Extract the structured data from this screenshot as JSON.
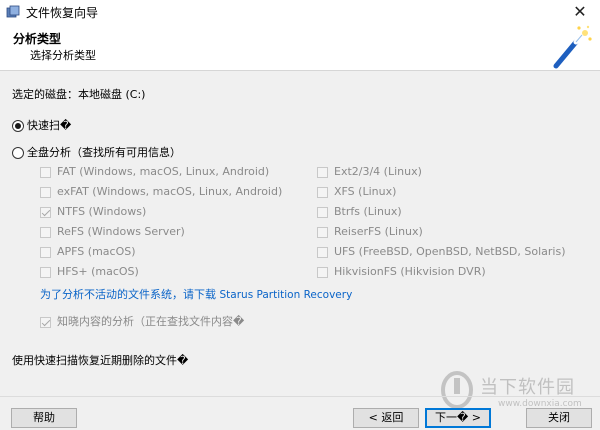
{
  "window": {
    "title": "文件恢复向导",
    "close_glyph": "✕"
  },
  "header": {
    "title": "分析类型",
    "subtitle": "选择分析类型"
  },
  "disk": {
    "label": "选定的磁盘：本地磁盘 (C:)"
  },
  "options": {
    "quick_scan": {
      "label": "快速扫�",
      "selected": true
    },
    "full_analysis": {
      "label": "全盘分析（查找所有可用信息）",
      "selected": false
    }
  },
  "filesystems": {
    "left": [
      {
        "label": "FAT (Windows, macOS, Linux, Android)",
        "checked": false
      },
      {
        "label": "exFAT (Windows, macOS, Linux, Android)",
        "checked": false
      },
      {
        "label": "NTFS (Windows)",
        "checked": true
      },
      {
        "label": "ReFS (Windows Server)",
        "checked": false
      },
      {
        "label": "APFS (macOS)",
        "checked": false
      },
      {
        "label": "HFS+ (macOS)",
        "checked": false
      }
    ],
    "right": [
      {
        "label": "Ext2/3/4 (Linux)",
        "checked": false
      },
      {
        "label": "XFS (Linux)",
        "checked": false
      },
      {
        "label": "Btrfs (Linux)",
        "checked": false
      },
      {
        "label": "ReiserFS (Linux)",
        "checked": false
      },
      {
        "label": "UFS (FreeBSD, OpenBSD, NetBSD, Solaris)",
        "checked": false
      },
      {
        "label": "HikvisionFS (Hikvision DVR)",
        "checked": false
      }
    ]
  },
  "link": {
    "prefix": "为了分析不活动的文件系统，请下载 ",
    "product": "Starus Partition Recovery"
  },
  "content_analysis": {
    "label": "知晓内容的分析（正在查找文件内容�",
    "checked": true
  },
  "hint": "使用快速扫描恢复近期删除的文件�",
  "buttons": {
    "help": "帮助",
    "back": "< 返回",
    "next": "下一� >",
    "close": "关闭"
  },
  "watermark": {
    "text": "当下软件园",
    "url": "www.downxia.com"
  },
  "colors": {
    "link": "#0a64c8",
    "accent": "#0078d7"
  }
}
